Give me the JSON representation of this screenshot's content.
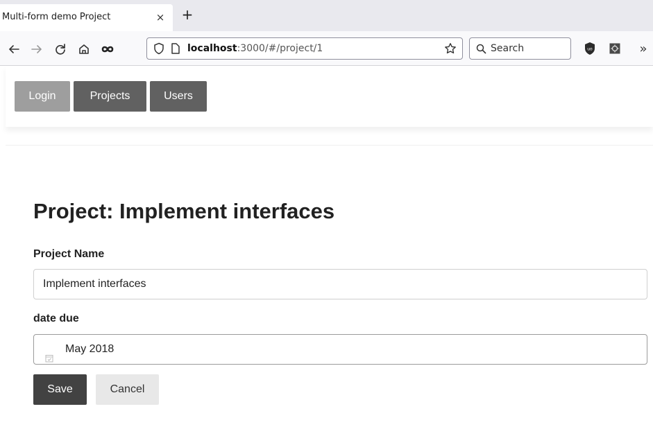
{
  "browser": {
    "tab_title": "Multi-form demo Project",
    "tab_close": "×",
    "new_tab": "+",
    "url_host": "localhost",
    "url_path": ":3000/#/project/1",
    "search_placeholder": "Search",
    "overflow": "»",
    "icons": [
      "back-arrow-icon",
      "forward-arrow-icon",
      "reload-icon",
      "home-icon",
      "infinity-icon",
      "shield-icon",
      "page-icon",
      "star-icon",
      "search-icon",
      "ublock-icon",
      "extension-icon",
      "overflow-chevron-icon"
    ]
  },
  "app_nav": {
    "items": [
      {
        "label": "Login",
        "color": "#9e9e9e"
      },
      {
        "label": "Projects",
        "color": "#616161"
      },
      {
        "label": "Users",
        "color": "#616161"
      }
    ]
  },
  "page": {
    "title": "Project: Implement interfaces"
  },
  "form": {
    "name_label": "Project Name",
    "name_value": "Implement interfaces",
    "due_label": "date due",
    "due_value": "May 2018",
    "save_label": "Save",
    "cancel_label": "Cancel",
    "save_color": "#424242",
    "cancel_color": "#e8e8e8"
  }
}
